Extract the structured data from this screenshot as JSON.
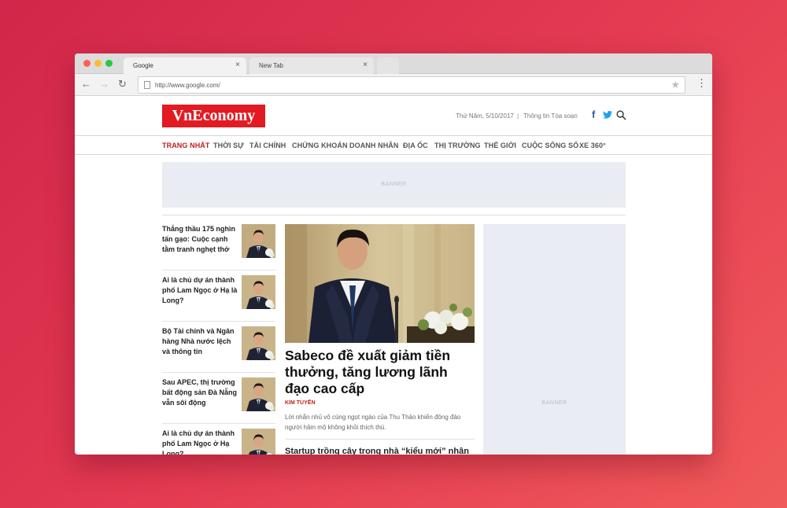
{
  "browser": {
    "tabs": [
      {
        "label": "Google"
      },
      {
        "label": "New Tab"
      }
    ],
    "tab_close_glyph": "×",
    "url": "http://www.google.com/"
  },
  "site": {
    "logo": "VnEconomy",
    "date": "Thứ Năm, 5/10/2017",
    "separator": "|",
    "toasoan": "Thông tin Tòa soạn",
    "menu": [
      "TRANG NHẤT",
      "THỜI SỰ",
      "TÀI CHÍNH",
      "CHỨNG KHOÁN",
      "DOANH NHÂN",
      "ĐỊA ỐC",
      "THỊ TRƯỜNG",
      "THẾ GIỚI",
      "CUỘC SỐNG SỐ",
      "XE 360°"
    ],
    "banner_label": "BANNER"
  },
  "news_list": [
    {
      "title": "Thắng thầu 175 nghìn tấn gạo: Cuộc cạnh tằm tranh nghẹt thở"
    },
    {
      "title": "Ai là chủ dự án thành phố Lam Ngọc ở Hạ là Long?"
    },
    {
      "title": "Bộ Tài chính và Ngân hàng Nhà nước lệch và thông tin"
    },
    {
      "title": "Sau APEC, thị trường bất động sản Đà Nẵng vẫn sôi động"
    },
    {
      "title": "Ai là chủ dự án thành phố Lam Ngọc ở Hạ Long?"
    }
  ],
  "main_story": {
    "headline": "Sabeco đề xuất giảm tiền thưởng, tăng lương lãnh đạo cao cấp",
    "author": "KIM TUYẾN",
    "excerpt": "Lời nhắn nhủ vô cùng ngọt ngào của Thu Thảo khiến đông đảo người hâm mộ không khỏi thích thú.",
    "second_title": "Startup trồng cây trong nhà “kiểu mới” nhận"
  },
  "colors": {
    "brand_red": "#e21b22",
    "menu_active": "#c21e1e",
    "facebook": "#3b5998",
    "twitter": "#1da1f2"
  },
  "icons": [
    "back-arrow-icon",
    "forward-arrow-icon",
    "reload-icon",
    "page-icon",
    "star-icon",
    "more-menu-icon",
    "facebook-icon",
    "twitter-icon",
    "search-icon"
  ]
}
